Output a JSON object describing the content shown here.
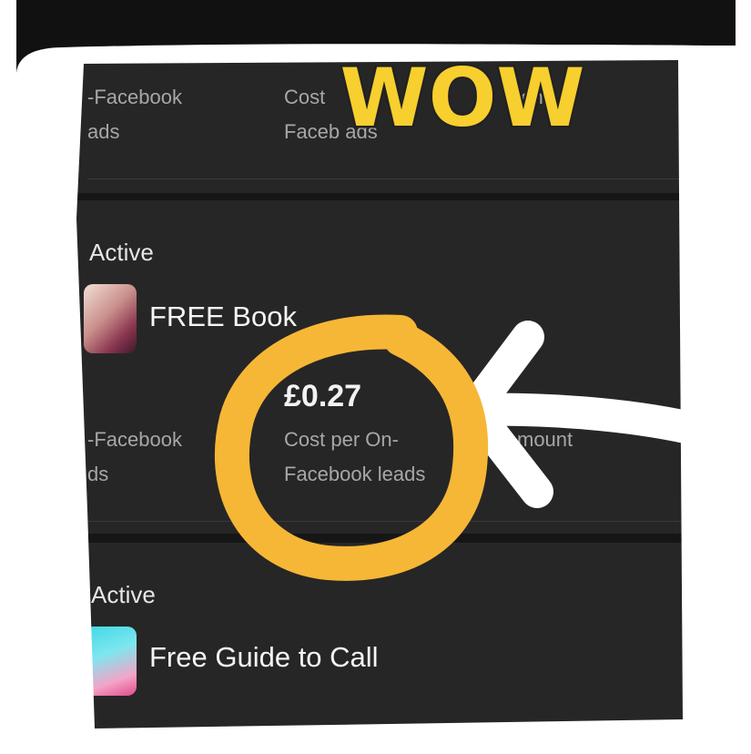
{
  "rows": [
    {
      "metrics": [
        {
          "label": "-Facebook\nads"
        },
        {
          "label": "Cost\nFaceb   ads"
        },
        {
          "label": "          pent"
        }
      ]
    },
    {
      "status": "Active",
      "title": "FREE Book",
      "metrics": [
        {
          "label": "-Facebook\nds"
        },
        {
          "value": "£0.27",
          "label": "Cost per On-\nFacebook leads"
        },
        {
          "label": "mount"
        }
      ]
    },
    {
      "status": "Active",
      "title": "Free Guide to Call"
    }
  ],
  "sticker": {
    "text": "WOW"
  },
  "colors": {
    "annotation_yellow": "#f6b736",
    "annotation_white": "#ffffff"
  }
}
